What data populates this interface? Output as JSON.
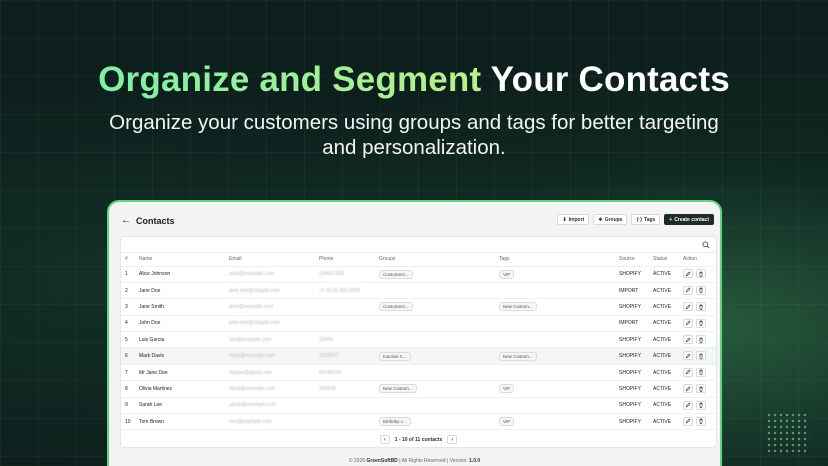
{
  "hero": {
    "title_accent": "Organize and Segment",
    "title_rest": "Your Contacts",
    "subtitle": "Organize your customers using groups and tags for better targeting and personalization."
  },
  "app": {
    "page_title": "Contacts",
    "buttons": {
      "import": "Import",
      "groups": "Groups",
      "tags": "Tags",
      "create": "Create contact"
    },
    "columns": [
      "#",
      "Name",
      "Email",
      "Phone",
      "Groups",
      "Tags",
      "Source",
      "Status",
      "Action"
    ],
    "rows": [
      {
        "n": "1",
        "name": "Alice Johnson",
        "email": "alice@example.com",
        "phone": "234567890",
        "group": "Customers...",
        "tag": "VIP",
        "source": "SHOPIFY",
        "status": "ACTIVE"
      },
      {
        "n": "2",
        "name": "Jane Doe",
        "email": "jane.doe@shopify.com",
        "phone": "+1 (613) 555-0100",
        "group": "",
        "tag": "",
        "source": "IMPORT",
        "status": "ACTIVE"
      },
      {
        "n": "3",
        "name": "Jane Smith",
        "email": "jane@example.com",
        "phone": "",
        "group": "Customers...",
        "tag": "New Custom...",
        "source": "SHOPIFY",
        "status": "ACTIVE"
      },
      {
        "n": "4",
        "name": "John Doe",
        "email": "john.doe@shopify.com",
        "phone": "",
        "group": "",
        "tag": "",
        "source": "IMPORT",
        "status": "ACTIVE"
      },
      {
        "n": "5",
        "name": "Luis Garcia",
        "email": "luis@example.com",
        "phone": "23456",
        "group": "",
        "tag": "",
        "source": "SHOPIFY",
        "status": "ACTIVE"
      },
      {
        "n": "6",
        "name": "Mark Davis",
        "email": "mark@example.com",
        "phone": "1234567",
        "group": "Inactive C...",
        "tag": "New Custom...",
        "source": "SHOPIFY",
        "status": "ACTIVE"
      },
      {
        "n": "7",
        "name": "Mr Jane Doe",
        "email": "mrjane@gmail.com",
        "phone": "09786546",
        "group": "",
        "tag": "",
        "source": "SHOPIFY",
        "status": "ACTIVE"
      },
      {
        "n": "8",
        "name": "Olivia Martinez",
        "email": "olivia@example.com",
        "phone": "345678",
        "group": "New Custom...",
        "tag": "VIP",
        "source": "SHOPIFY",
        "status": "ACTIVE"
      },
      {
        "n": "9",
        "name": "Sarah Lee",
        "email": "sarah@example.com",
        "phone": "",
        "group": "",
        "tag": "",
        "source": "SHOPIFY",
        "status": "ACTIVE"
      },
      {
        "n": "10",
        "name": "Tom Brown",
        "email": "tom@example.com",
        "phone": "",
        "group": "Birthday c...",
        "tag": "VIP",
        "source": "SHOPIFY",
        "status": "ACTIVE"
      }
    ],
    "pagination": "1 - 10 of 11 contacts",
    "footer": {
      "prefix": "© 2025",
      "brand": "GreenSoftBD",
      "middle": "| All Rights Reserved | Version:",
      "version": "1.0.0"
    }
  },
  "colors": {
    "accent": "#5dd879",
    "primary_button": "#1f2b28",
    "background": "#0d1f1c"
  },
  "icons": [
    "back-arrow-icon",
    "import-icon",
    "groups-icon",
    "tags-icon",
    "plus-icon",
    "search-icon",
    "edit-icon",
    "delete-icon",
    "chevron-left-icon",
    "chevron-right-icon"
  ]
}
